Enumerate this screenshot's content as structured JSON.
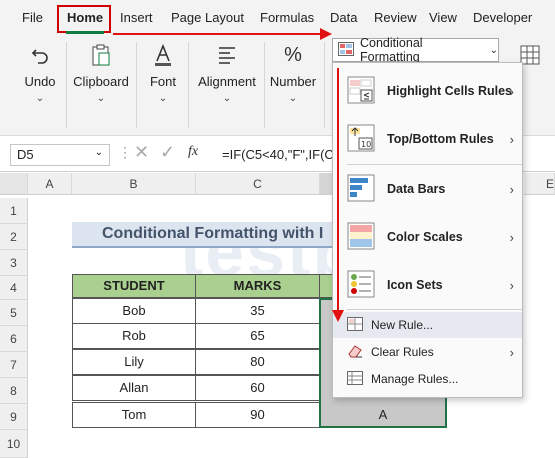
{
  "menu": [
    "File",
    "Home",
    "Insert",
    "Page Layout",
    "Formulas",
    "Data",
    "Review",
    "View",
    "Developer"
  ],
  "ribbon": {
    "undo": "Undo",
    "clipboard": "Clipboard",
    "font": "Font",
    "alignment": "Alignment",
    "number": "Number",
    "conditional_formatting": "Conditional Formatting"
  },
  "formula_bar": {
    "cell": "D5",
    "formula": "=IF(C5<40,\"F\",IF(C"
  },
  "columns": [
    "A",
    "B",
    "C",
    "E"
  ],
  "rows": [
    "1",
    "2",
    "3",
    "4",
    "5",
    "6",
    "7",
    "8",
    "9",
    "10"
  ],
  "title": "Conditional Formatting with I",
  "watermark": "testbook",
  "table": {
    "headers": [
      "STUDENT",
      "MARKS"
    ],
    "rows": [
      {
        "student": "Bob",
        "marks": "35"
      },
      {
        "student": "Rob",
        "marks": "65"
      },
      {
        "student": "Lily",
        "marks": "80"
      },
      {
        "student": "Allan",
        "marks": "60"
      },
      {
        "student": "Tom",
        "marks": "90"
      }
    ],
    "grade_visible": "A"
  },
  "dropdown": {
    "highlight": "Highlight Cells Rules",
    "topbottom": "Top/Bottom Rules",
    "databars": "Data Bars",
    "colorscales": "Color Scales",
    "iconsets": "Icon Sets",
    "newrule": "New Rule...",
    "clearrules": "Clear Rules",
    "managerules": "Manage Rules..."
  },
  "colors": {
    "accent": "#107c41",
    "highlight": "#d00000",
    "header_green": "#a9d08e"
  }
}
